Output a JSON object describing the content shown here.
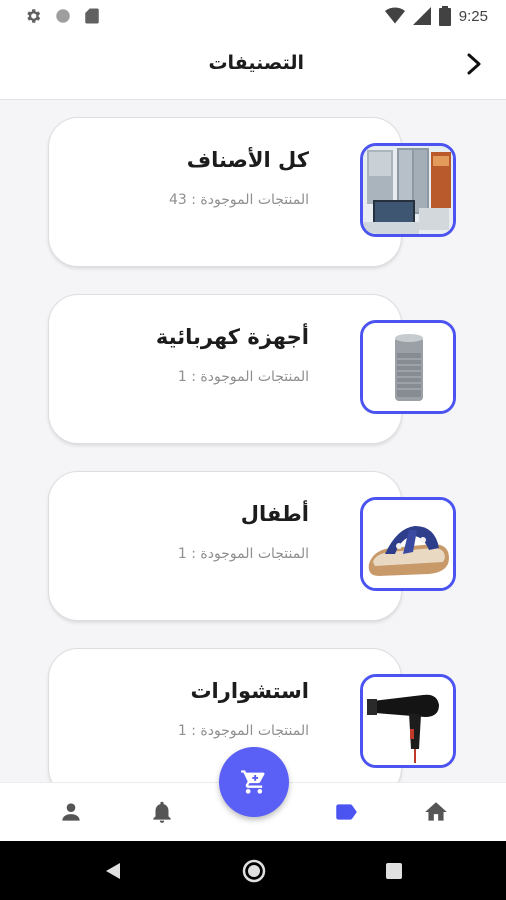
{
  "status_bar": {
    "time": "9:25",
    "icons": [
      "gear-icon",
      "circle-icon",
      "sd-card-icon",
      "wifi-icon",
      "signal-icon",
      "battery-icon"
    ]
  },
  "header": {
    "title": "التصنيفات",
    "back_icon": "chevron-right-icon"
  },
  "categories": [
    {
      "name": "كل الأصناف",
      "count_text": "المنتجات الموجودة : 43",
      "image": "appliances-image"
    },
    {
      "name": "أجهزة كهربائية",
      "count_text": "المنتجات الموجودة : 1",
      "image": "speaker-image"
    },
    {
      "name": "أطفال",
      "count_text": "المنتجات الموجودة : 1",
      "image": "sandal-image"
    },
    {
      "name": "استشوارات",
      "count_text": "المنتجات الموجودة : 1",
      "image": "hair-dryer-image"
    }
  ],
  "bottom_nav": {
    "items": [
      "profile-icon",
      "bell-icon",
      "label-icon",
      "home-icon"
    ],
    "active": "label-icon",
    "fab_icon": "cart-icon"
  },
  "colors": {
    "accent": "#4b54f1",
    "fab": "#5a5ff6",
    "background": "#f5f5f7"
  }
}
